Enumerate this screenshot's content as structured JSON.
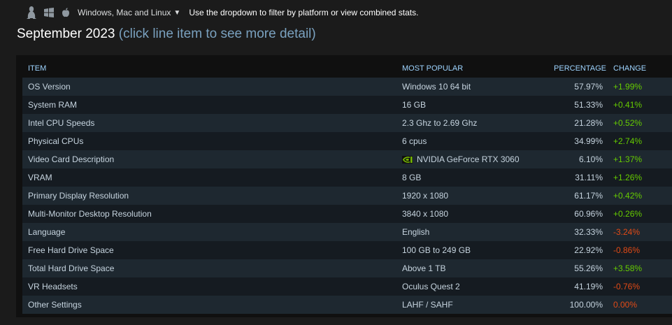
{
  "platform": {
    "icons": [
      "linux-icon",
      "windows-icon",
      "apple-icon"
    ],
    "selected": "Windows, Mac and Linux",
    "hint": "Use the dropdown to filter by platform or view combined stats."
  },
  "heading": {
    "title": "September 2023",
    "subtitle": "(click line item to see more detail)"
  },
  "table": {
    "headers": {
      "item": "ITEM",
      "popular": "MOST POPULAR",
      "percentage": "PERCENTAGE",
      "change": "CHANGE"
    },
    "rows": [
      {
        "item": "OS Version",
        "popular": "Windows 10 64 bit",
        "percentage": "57.97%",
        "change": "+1.99%",
        "trend": "pos"
      },
      {
        "item": "System RAM",
        "popular": "16 GB",
        "percentage": "51.33%",
        "change": "+0.41%",
        "trend": "pos"
      },
      {
        "item": "Intel CPU Speeds",
        "popular": "2.3 Ghz to 2.69 Ghz",
        "percentage": "21.28%",
        "change": "+0.52%",
        "trend": "pos"
      },
      {
        "item": "Physical CPUs",
        "popular": "6 cpus",
        "percentage": "34.99%",
        "change": "+2.74%",
        "trend": "pos"
      },
      {
        "item": "Video Card Description",
        "popular": "NVIDIA GeForce RTX 3060",
        "percentage": "6.10%",
        "change": "+1.37%",
        "trend": "pos",
        "icon": "nvidia-icon"
      },
      {
        "item": "VRAM",
        "popular": "8 GB",
        "percentage": "31.11%",
        "change": "+1.26%",
        "trend": "pos"
      },
      {
        "item": "Primary Display Resolution",
        "popular": "1920 x 1080",
        "percentage": "61.17%",
        "change": "+0.42%",
        "trend": "pos"
      },
      {
        "item": "Multi-Monitor Desktop Resolution",
        "popular": "3840 x 1080",
        "percentage": "60.96%",
        "change": "+0.26%",
        "trend": "pos"
      },
      {
        "item": "Language",
        "popular": "English",
        "percentage": "32.33%",
        "change": "-3.24%",
        "trend": "neg"
      },
      {
        "item": "Free Hard Drive Space",
        "popular": "100 GB to 249 GB",
        "percentage": "22.92%",
        "change": "-0.86%",
        "trend": "neg"
      },
      {
        "item": "Total Hard Drive Space",
        "popular": "Above 1 TB",
        "percentage": "55.26%",
        "change": "+3.58%",
        "trend": "pos"
      },
      {
        "item": "VR Headsets",
        "popular": "Oculus Quest 2",
        "percentage": "41.19%",
        "change": "-0.76%",
        "trend": "neg"
      },
      {
        "item": "Other Settings",
        "popular": "LAHF / SAHF",
        "percentage": "100.00%",
        "change": "0.00%",
        "trend": "neg"
      }
    ]
  },
  "colors": {
    "positive": "#66cc00",
    "negative": "#e24a16",
    "header": "#9ed4ff",
    "subtitle": "#7aa1bf"
  }
}
